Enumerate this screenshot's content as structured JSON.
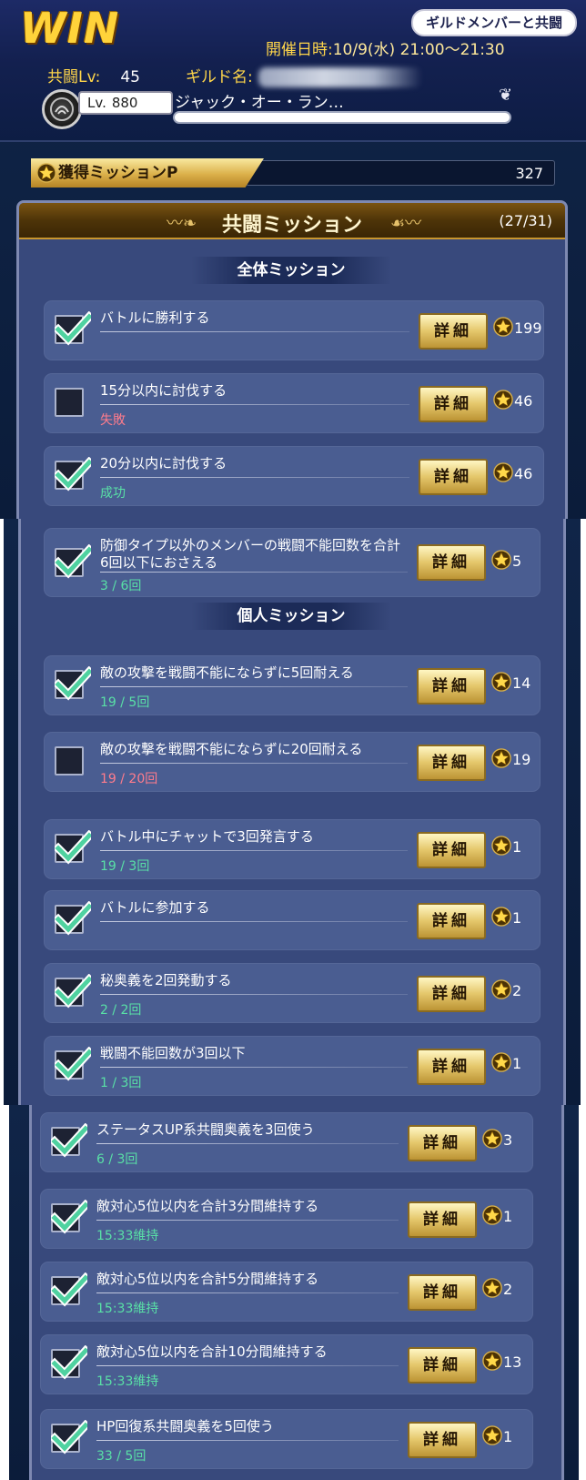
{
  "header": {
    "result": "WIN",
    "mode": "ギルドメンバーと共闘",
    "schedule_label": "開催日時:",
    "schedule_value": "10/9(水) 21:00～21:30",
    "coop_lv_label": "共闘Lv:",
    "coop_lv_value": "45",
    "guild_label": "ギルド名:",
    "player_lv_label": "Lv.",
    "player_lv_value": "880",
    "player_name": "ジャック・オー・ラン…"
  },
  "mission_points": {
    "label": "獲得ミッションP",
    "value": "327"
  },
  "section": {
    "title": "共闘ミッション",
    "count": "(27/31)"
  },
  "groups": {
    "overall": "全体ミッション",
    "personal": "個人ミッション"
  },
  "detail_label": "詳細",
  "missions": [
    {
      "title": "バトルに勝利する",
      "status": "",
      "reward": "199",
      "done": true
    },
    {
      "title": "15分以内に討伐する",
      "status": "失敗",
      "reward": "46",
      "done": false
    },
    {
      "title": "20分以内に討伐する",
      "status": "成功",
      "reward": "46",
      "done": true
    },
    {
      "title": "防御タイプ以外のメンバーの戦闘不能回数を合計6回以下におさえる",
      "status": "3 / 6回",
      "reward": "5",
      "done": true
    },
    {
      "title": "敵の攻撃を戦闘不能にならずに5回耐える",
      "status": "19 / 5回",
      "reward": "14",
      "done": true
    },
    {
      "title": "敵の攻撃を戦闘不能にならずに20回耐える",
      "status": "19 / 20回",
      "reward": "19",
      "done": false
    },
    {
      "title": "バトル中にチャットで3回発言する",
      "status": "19 / 3回",
      "reward": "1",
      "done": true
    },
    {
      "title": "バトルに参加する",
      "status": "",
      "reward": "1",
      "done": true
    },
    {
      "title": "秘奥義を2回発動する",
      "status": "2 / 2回",
      "reward": "2",
      "done": true
    },
    {
      "title": "戦闘不能回数が3回以下",
      "status": "1 / 3回",
      "reward": "1",
      "done": true
    },
    {
      "title": "ステータスUP系共闘奥義を3回使う",
      "status": "6 / 3回",
      "reward": "3",
      "done": true
    },
    {
      "title": "敵対心5位以内を合計3分間維持する",
      "status": "15:33維持",
      "reward": "1",
      "done": true
    },
    {
      "title": "敵対心5位以内を合計5分間維持する",
      "status": "15:33維持",
      "reward": "2",
      "done": true
    },
    {
      "title": "敵対心5位以内を合計10分間維持する",
      "status": "15:33維持",
      "reward": "13",
      "done": true
    },
    {
      "title": "HP回復系共闘奥義を5回使う",
      "status": "33 / 5回",
      "reward": "1",
      "done": true
    }
  ],
  "colors": {
    "gold": "#ffd64a",
    "success": "#59e0a6",
    "fail": "#ff7c8c",
    "card": "#4a5d91"
  },
  "icons": {
    "check": "check-icon",
    "star": "star-icon",
    "emblem": "guild-emblem-icon",
    "feather": "feather-icon"
  }
}
